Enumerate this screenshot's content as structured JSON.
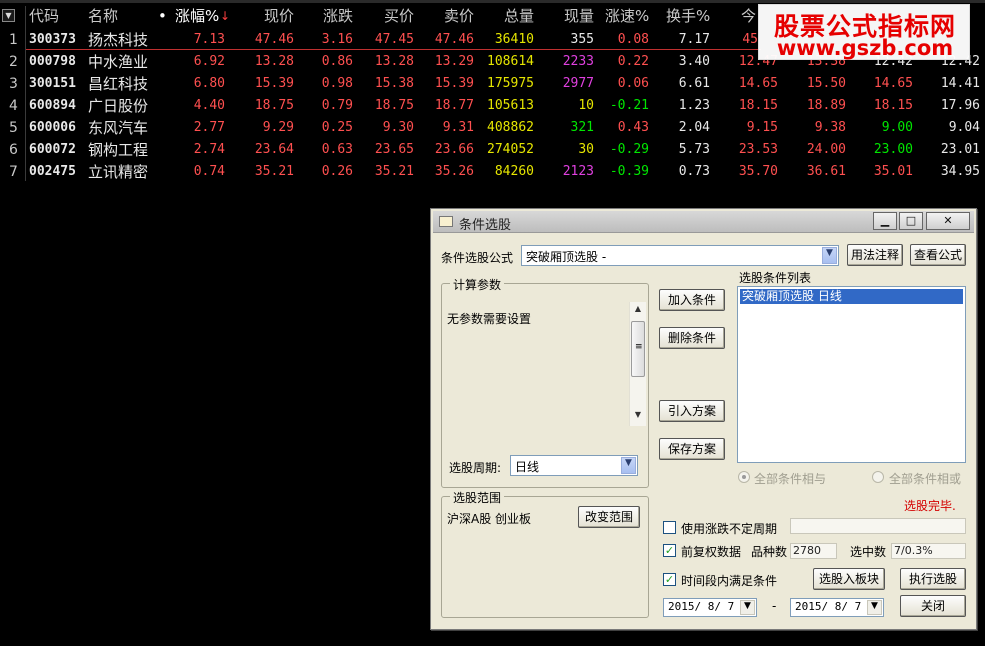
{
  "watermark": {
    "line1": "股票公式指标网",
    "line2": "www.gszb.com"
  },
  "grid": {
    "sort_glyph": "▼",
    "columns": {
      "code": "代码",
      "name": "名称",
      "dot": "•",
      "change_pct": "涨幅%",
      "sort_arrow": "↓",
      "price": "现价",
      "change": "涨跌",
      "bid": "买价",
      "ask": "卖价",
      "volume": "总量",
      "cur_vol": "现量",
      "speed": "涨速%",
      "turnover": "换手%",
      "open": "今"
    },
    "rows": [
      {
        "idx": "1",
        "code": "300373",
        "name": "扬杰科技",
        "change_pct": "7.13",
        "price": "47.46",
        "change": "3.16",
        "bid": "47.45",
        "ask": "47.46",
        "volume": "36410",
        "cur_vol": "355",
        "speed": "0.08",
        "turnover": "7.17",
        "open": "45",
        "high": "",
        "low": "",
        "prev": ""
      },
      {
        "idx": "2",
        "code": "000798",
        "name": "中水渔业",
        "change_pct": "6.92",
        "price": "13.28",
        "change": "0.86",
        "bid": "13.28",
        "ask": "13.29",
        "volume": "108614",
        "cur_vol": "2233",
        "speed": "0.22",
        "turnover": "3.40",
        "open": "12.47",
        "high": "13.38",
        "low": "12.42",
        "prev": "12.42"
      },
      {
        "idx": "3",
        "code": "300151",
        "name": "昌红科技",
        "change_pct": "6.80",
        "price": "15.39",
        "change": "0.98",
        "bid": "15.38",
        "ask": "15.39",
        "volume": "175975",
        "cur_vol": "2977",
        "speed": "0.06",
        "turnover": "6.61",
        "open": "14.65",
        "high": "15.50",
        "low": "14.65",
        "prev": "14.41"
      },
      {
        "idx": "4",
        "code": "600894",
        "name": "广日股份",
        "change_pct": "4.40",
        "price": "18.75",
        "change": "0.79",
        "bid": "18.75",
        "ask": "18.77",
        "volume": "105613",
        "cur_vol": "10",
        "speed": "-0.21",
        "turnover": "1.23",
        "open": "18.15",
        "high": "18.89",
        "low": "18.15",
        "prev": "17.96"
      },
      {
        "idx": "5",
        "code": "600006",
        "name": "东风汽车",
        "change_pct": "2.77",
        "price": "9.29",
        "change": "0.25",
        "bid": "9.30",
        "ask": "9.31",
        "volume": "408862",
        "cur_vol": "321",
        "speed": "0.43",
        "turnover": "2.04",
        "open": "9.15",
        "high": "9.38",
        "low": "9.00",
        "prev": "9.04"
      },
      {
        "idx": "6",
        "code": "600072",
        "name": "钢构工程",
        "change_pct": "2.74",
        "price": "23.64",
        "change": "0.63",
        "bid": "23.65",
        "ask": "23.66",
        "volume": "274052",
        "cur_vol": "30",
        "speed": "-0.29",
        "turnover": "5.73",
        "open": "23.53",
        "high": "24.00",
        "low": "23.00",
        "prev": "23.01"
      },
      {
        "idx": "7",
        "code": "002475",
        "name": "立讯精密",
        "change_pct": "0.74",
        "price": "35.21",
        "change": "0.26",
        "bid": "35.21",
        "ask": "35.26",
        "volume": "84260",
        "cur_vol": "2123",
        "speed": "-0.39",
        "turnover": "0.73",
        "open": "35.70",
        "high": "36.61",
        "low": "35.01",
        "prev": "34.95"
      }
    ]
  },
  "dialog": {
    "title": "条件选股",
    "btn_min": "▁",
    "btn_max": "□",
    "btn_close": "✕",
    "formula_label": "条件选股公式",
    "formula_value": "突破厢顶选股 -",
    "combo_arrow": "▼",
    "usage_btn": "用法注释",
    "view_formula_btn": "查看公式",
    "params_group": "计算参数",
    "no_params": "无参数需要设置",
    "scroll_up": "▲",
    "scroll_grip": "≡",
    "scroll_down": "▼",
    "period_label": "选股周期:",
    "period_value": "日线",
    "add_btn": "加入条件",
    "delete_btn": "删除条件",
    "import_btn": "引入方案",
    "save_btn": "保存方案",
    "cond_list_label": "选股条件列表",
    "cond_list_items": [
      "突破厢顶选股  日线"
    ],
    "radio_and": "全部条件相与",
    "radio_or": "全部条件相或",
    "status": "选股完毕.",
    "scope_group": "选股范围",
    "scope_value": "沪深A股 创业板",
    "change_scope_btn": "改变范围",
    "check_mark": "✓",
    "use_uncertain": "使用涨跌不定周期",
    "fq_label": "前复权数据",
    "count_label": "品种数",
    "count_value": "2780",
    "selected_label": "选中数",
    "selected_value": "7/0.3%",
    "in_period_label": "时间段内满足条件",
    "to_block_btn": "选股入板块",
    "execute_btn": "执行选股",
    "date_from": "2015/ 8/ 7",
    "date_sep": "-",
    "date_to": "2015/ 8/ 7",
    "close_btn": "关闭"
  }
}
